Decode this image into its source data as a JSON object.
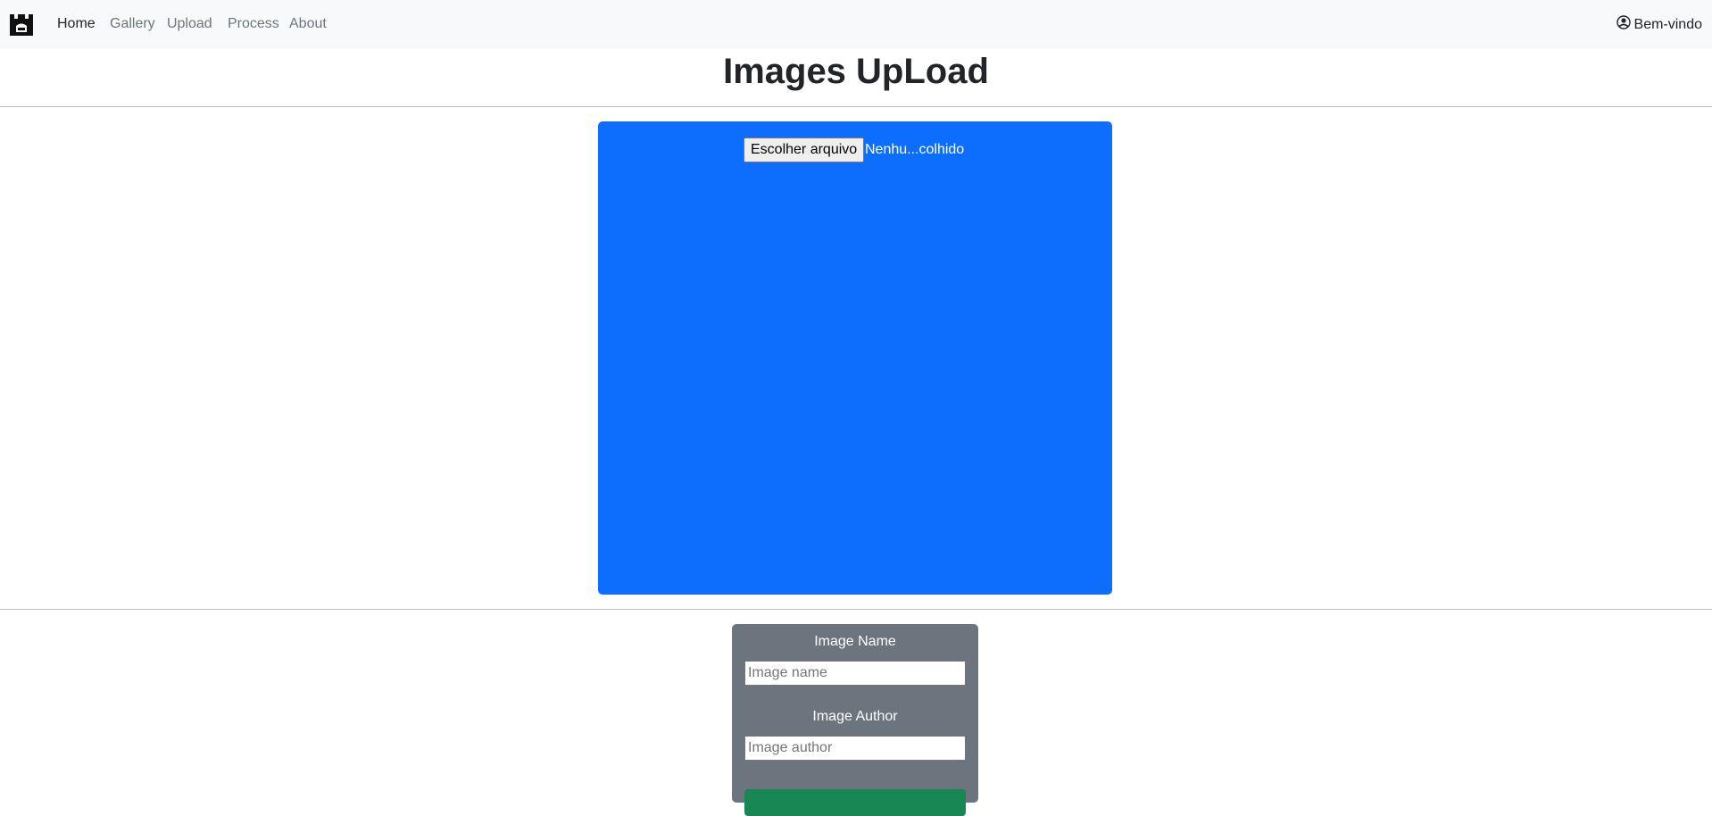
{
  "navbar": {
    "brand_icon": "castle-logo-icon",
    "links": [
      {
        "label": "Home",
        "active": true
      },
      {
        "label": "Gallery",
        "active": false
      },
      {
        "label": "Upload",
        "active": false
      },
      {
        "label": "Process",
        "active": false
      },
      {
        "label": "About",
        "active": false
      }
    ],
    "user_icon": "person-circle-icon",
    "user_label": "Bem-vindo"
  },
  "page": {
    "title": "Images UpLoad"
  },
  "upload": {
    "choose_file_label": "Escolher arquivo",
    "file_status": "Nenhu...colhido",
    "dropzone_color": "#0d6efd"
  },
  "form": {
    "name_label": "Image Name",
    "name_placeholder": "Image name",
    "name_value": "",
    "author_label": "Image Author",
    "author_placeholder": "Image author",
    "author_value": "",
    "card_color": "#6c757d",
    "submit_color": "#198754"
  }
}
